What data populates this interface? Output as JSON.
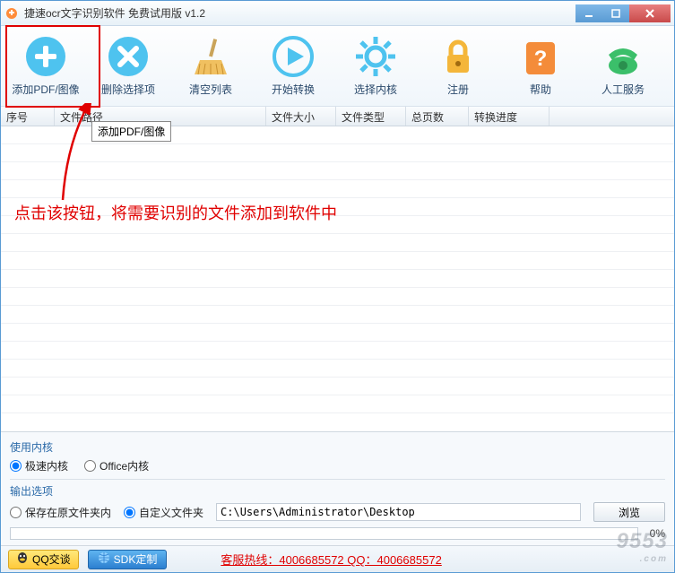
{
  "window": {
    "title": "捷速ocr文字识别软件 免费试用版 v1.2"
  },
  "toolbar": {
    "add": "添加PDF/图像",
    "delete": "删除选择项",
    "clear": "清空列表",
    "start": "开始转换",
    "kernel": "选择内核",
    "register": "注册",
    "help": "帮助",
    "service": "人工服务"
  },
  "tooltip": "添加PDF/图像",
  "columns": {
    "c0": "序号",
    "c1": "文件路径",
    "c2": "文件大小",
    "c3": "文件类型",
    "c4": "总页数",
    "c5": "转换进度"
  },
  "annotation": "点击该按钮，将需要识别的文件添加到软件中",
  "kernel_section": {
    "title": "使用内核",
    "fast": "极速内核",
    "office": "Office内核",
    "selected": "fast"
  },
  "output_section": {
    "title": "输出选项",
    "keep": "保存在原文件夹内",
    "custom": "自定义文件夹",
    "selected": "custom",
    "path": "C:\\Users\\Administrator\\Desktop",
    "browse": "浏览"
  },
  "progress": {
    "percent": "0%"
  },
  "footer": {
    "qq": "QQ交谈",
    "sdk": "SDK定制",
    "hotline": "客服热线：4006685572 QQ：4006685572"
  },
  "watermark": {
    "main": "9553",
    "sub": ".com"
  }
}
